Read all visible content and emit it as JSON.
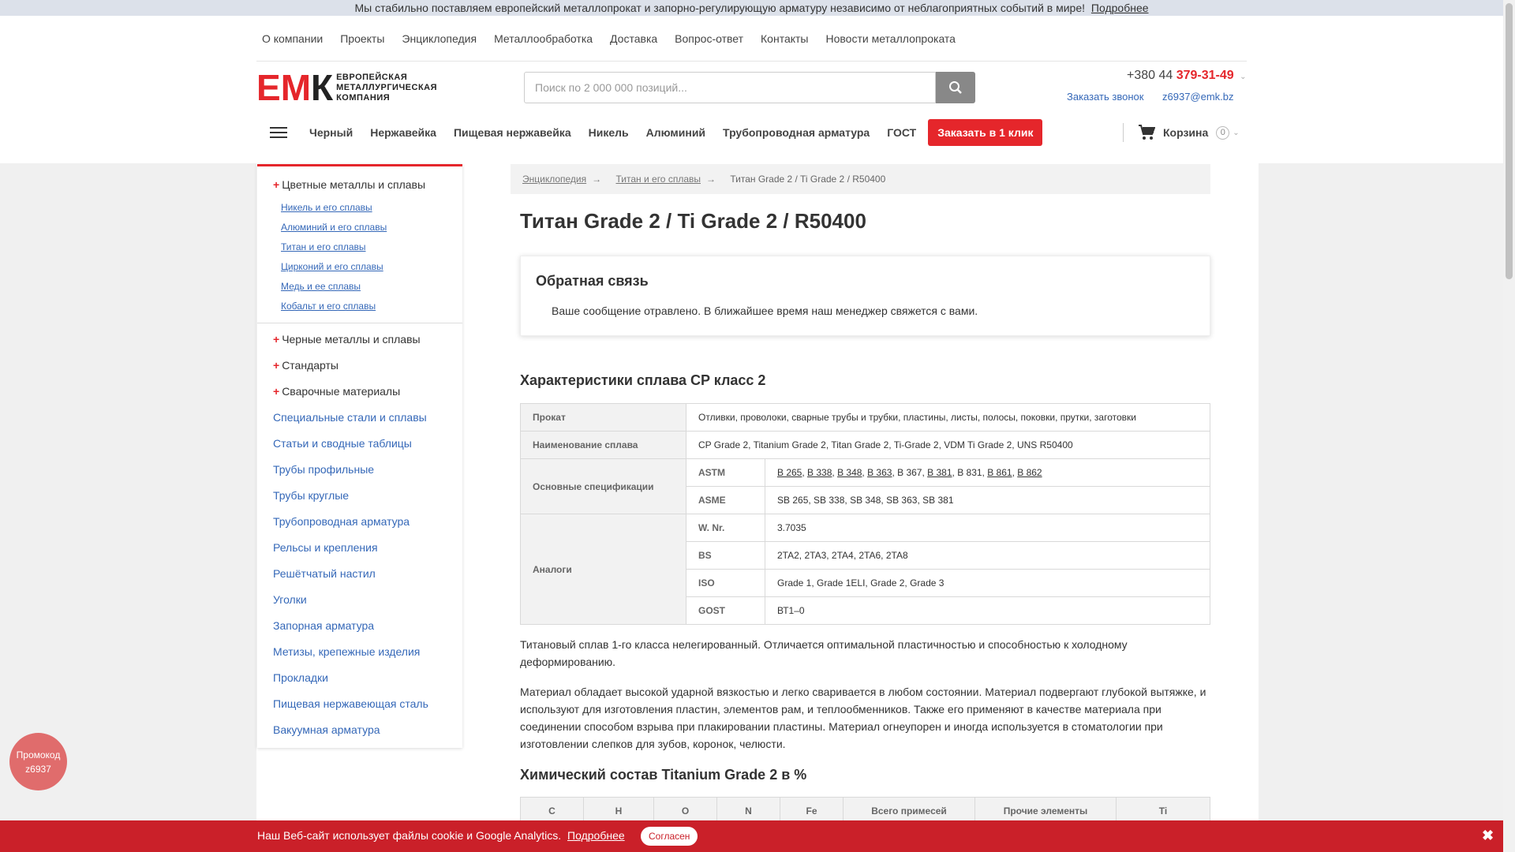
{
  "topbar": {
    "message": "Мы стабильно поставляем европейский металлопрокат и запорно-регулирующую арматуру независимо от неблагоприятных событий в мире!",
    "link": "Подробнее"
  },
  "topnav": [
    "О компании",
    "Проекты",
    "Энциклопедия",
    "Металлообработка",
    "Доставка",
    "Вопрос-ответ",
    "Контакты",
    "Новости металлопроката"
  ],
  "logo": {
    "mark_e": "Е",
    "mark_m": "М",
    "mark_k": "К",
    "line1": "ЕВРОПЕЙСКАЯ",
    "line2": "МЕТАЛЛУРГИЧЕСКАЯ",
    "line3": "КОМПАНИЯ"
  },
  "search": {
    "placeholder": "Поиск по 2 000 000 позиций...",
    "icon": "search-icon"
  },
  "contacts": {
    "phone_prefix": "+380 44",
    "phone_number": "379-31-49",
    "callback": "Заказать звонок",
    "email": "z6937@emk.bz"
  },
  "catnav": {
    "items": [
      "Черный",
      "Нержавейка",
      "Пищевая нержавейка",
      "Никель",
      "Алюминий",
      "Трубопроводная арматура",
      "ГОСТ"
    ],
    "cta": "Заказать в 1 клик"
  },
  "cart": {
    "label": "Корзина",
    "count": "0",
    "icon": "cart-icon"
  },
  "sidebar": {
    "open_section": "Цветные металлы и сплавы",
    "sub_items": [
      "Никель и его сплавы",
      "Алюминий и его сплавы",
      "Титан и его сплавы",
      "Цирконий и его сплавы",
      "Медь и ее сплавы",
      "Кобальт и его сплавы"
    ],
    "collapsed": [
      "Черные металлы и сплавы",
      "Стандарты",
      "Сварочные материалы"
    ],
    "links": [
      "Специальные стали и сплавы",
      "Статьи и сводные таблицы",
      "Трубы профильные",
      "Трубы круглые",
      "Трубопроводная арматура",
      "Рельсы и крепления",
      "Решётчатый настил",
      "Уголки",
      "Запорная арматура",
      "Метизы, крепежные изделия",
      "Прокладки",
      "Пищевая нержавеющая сталь",
      "Вакуумная арматура"
    ]
  },
  "breadcrumb": [
    "Энциклопедия",
    "Титан и его сплавы",
    "Титан Grade 2 / Ti Grade 2 / R50400"
  ],
  "page_title": "Титан Grade 2 / Ti Grade 2 / R50400",
  "feedback": {
    "title": "Обратная связь",
    "message": "Ваше сообщение отравлено. В ближайшее время наш менеджер свяжется с вами."
  },
  "spec_title": "Характеристики сплава CP класс 2",
  "spec": {
    "prokat_label": "Прокат",
    "prokat_value": "Отливки, проволоки, сварные трубы и трубки, пластины, листы, полосы, поковки, прутки, заготовки",
    "name_label": "Наименование сплава",
    "name_value": "CP Grade 2, Titanium Grade 2, Titan Grade 2, Ti-Grade 2, VDM Ti Grade 2, UNS R50400",
    "specs_label": "Основные спецификации",
    "astm_label": "ASTM",
    "astm": [
      {
        "text": "B 265",
        "link": true
      },
      {
        "text": "B 338",
        "link": true
      },
      {
        "text": "B 348",
        "link": true
      },
      {
        "text": "B 363",
        "link": true
      },
      {
        "text": "B 367",
        "link": false
      },
      {
        "text": "B 381",
        "link": true
      },
      {
        "text": "B 831",
        "link": false
      },
      {
        "text": "B 861",
        "link": true
      },
      {
        "text": "B 862",
        "link": true
      }
    ],
    "asme_label": "ASME",
    "asme_value": "SB 265, SB 338, SB 348, SB 363, SB 381",
    "analogs_label": "Аналоги",
    "wnr_label": "W. Nr.",
    "wnr_value": "3.7035",
    "bs_label": "BS",
    "bs_value": "2TA2, 2TA3, 2TA4, 2TA6, 2TA8",
    "iso_label": "ISO",
    "iso_value": "Grade 1, Grade 1ELI, Grade 2, Grade 3",
    "gost_label": "GOST",
    "gost_value": "ВТ1–0"
  },
  "paragraphs": [
    "Титановый сплав 1-го класса нелегированный. Отличается оптимальной пластичностью и способностью к холодному деформированию.",
    "Материал обладает высокой ударной вязкостью и легко сваривается в любом состоянии. Материал подвергают глубокой вытяжке, и используют для изготовления пластин, элементов рам, и теплообменников. Также его применяют в качестве материала при соединении способом взрыва при плакировании пластины. Материал огнеупорен и иногда используется в стоматологии при изготовлении слепков для зубов, коронок, челюсти."
  ],
  "chem_title": "Химический состав Titanium Grade 2 в %",
  "chem_headers": [
    "C",
    "H",
    "O",
    "N",
    "Fe",
    "Всего примесей",
    "Прочие элементы",
    "Ti"
  ],
  "promo": {
    "line1": "Промокод",
    "line2": "z6937"
  },
  "cookie": {
    "message": "Наш Веб-сайт использует файлы cookie и Google Analytics.",
    "link": "Подробнее",
    "accept": "Согласен",
    "close": "✖"
  },
  "colors": {
    "accent": "#e5262b",
    "link": "#3568b8",
    "cookie_bg": "#ca2029"
  }
}
